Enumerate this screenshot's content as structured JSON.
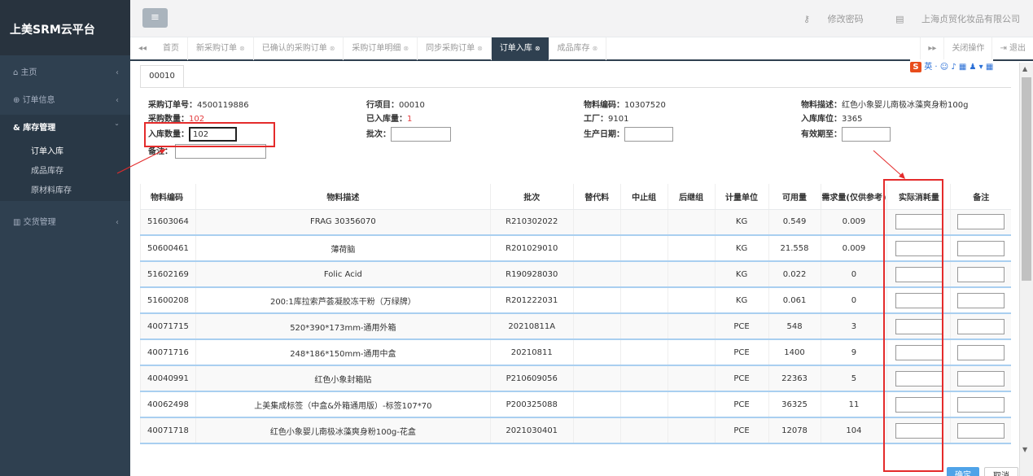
{
  "app": {
    "title": "上美SRM云平台"
  },
  "sidebar": {
    "items": [
      {
        "icon": "home-icon",
        "label": "主页",
        "chev": "‹"
      },
      {
        "icon": "order-icon",
        "label": "订单信息",
        "chev": "‹"
      },
      {
        "icon": "warehouse-icon",
        "label": "库存管理",
        "chev": "ˇ",
        "active": true
      },
      {
        "icon": "chart-icon",
        "label": "交货管理",
        "chev": "‹"
      }
    ],
    "sub_items": [
      "订单入库",
      "成品库存",
      "原材料库存"
    ]
  },
  "header": {
    "menu_glyph": "≡",
    "change_password": "修改密码",
    "company": "上海贞贸化妆品有限公司"
  },
  "tabs": {
    "left_arrow": "◂◂",
    "items": [
      "首页",
      "新采购订单",
      "已确认的采购订单",
      "采购订单明细",
      "同步采购订单",
      "订单入库",
      "成品库存"
    ],
    "active": "订单入库",
    "right_arrow": "▸▸",
    "close_ops": "关闭操作",
    "logout": "退出"
  },
  "ime": {
    "badge": "S",
    "label": "英"
  },
  "inner_tab": "00010",
  "form": {
    "po_label": "采购订单号：",
    "po_value": "4500119886",
    "line_label": "行项目：",
    "line_value": "00010",
    "material_label": "物料编码：",
    "material_value": "10307520",
    "desc_label": "物料描述：",
    "desc_value": "红色小象婴儿南极冰藻爽身粉100g",
    "qty_label": "采购数量：",
    "qty_value": "102",
    "received_label": "已入库量：",
    "received_value": "1",
    "plant_label": "工厂：",
    "plant_value": "9101",
    "location_label": "入库库位：",
    "location_value": "3365",
    "inqty_label": "入库数量：",
    "inqty_value": "102",
    "batch_label": "批次：",
    "prod_date_label": "生产日期：",
    "expiry_label": "有效期至：",
    "remark_label": "备注："
  },
  "table": {
    "headers": [
      "物料编码",
      "物料描述",
      "批次",
      "替代料",
      "中止组",
      "后继组",
      "计量单位",
      "可用量",
      "需求量(仅供参考)",
      "实际消耗量",
      "备注"
    ],
    "rows": [
      [
        "51603064",
        "FRAG 30356070",
        "R210302022",
        "",
        "",
        "",
        "KG",
        "0.549",
        "0.009"
      ],
      [
        "50600461",
        "薄荷脑",
        "R201029010",
        "",
        "",
        "",
        "KG",
        "21.558",
        "0.009"
      ],
      [
        "51602169",
        "Folic Acid",
        "R190928030",
        "",
        "",
        "",
        "KG",
        "0.022",
        "0"
      ],
      [
        "51600208",
        "200:1库拉索芦荟凝胶冻干粉（万绿牌）",
        "R201222031",
        "",
        "",
        "",
        "KG",
        "0.061",
        "0"
      ],
      [
        "40071715",
        "520*390*173mm-通用外箱",
        "20210811A",
        "",
        "",
        "",
        "PCE",
        "548",
        "3"
      ],
      [
        "40071716",
        "248*186*150mm-通用中盒",
        "20210811",
        "",
        "",
        "",
        "PCE",
        "1400",
        "9"
      ],
      [
        "40040991",
        "红色小象封箱贴",
        "P210609056",
        "",
        "",
        "",
        "PCE",
        "22363",
        "5"
      ],
      [
        "40062498",
        "上美集成标签（中盒&外箱通用版）-标签107*70",
        "P200325088",
        "",
        "",
        "",
        "PCE",
        "36325",
        "11"
      ],
      [
        "40071718",
        "红色小象婴儿南极冰藻爽身粉100g-花盒",
        "2021030401",
        "",
        "",
        "",
        "PCE",
        "12078",
        "104"
      ]
    ]
  },
  "buttons": {
    "ok": "确定",
    "cancel": "取消"
  },
  "colors": {
    "sidebar": "#2f4050",
    "highlight": "#e42b2b",
    "row_line": "#a9cff0"
  }
}
